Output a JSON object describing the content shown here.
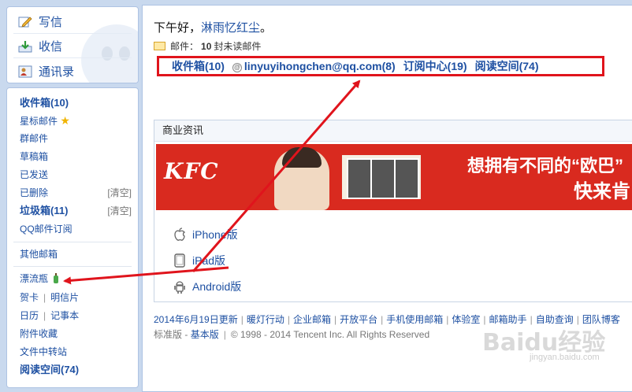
{
  "quick_actions": [
    {
      "label": "写信",
      "icon": "pencil-icon"
    },
    {
      "label": "收信",
      "icon": "inbox-download-icon"
    },
    {
      "label": "通讯录",
      "icon": "contacts-icon"
    }
  ],
  "nav": {
    "inbox": "收件箱(10)",
    "starred": "星标邮件",
    "group": "群邮件",
    "drafts": "草稿箱",
    "sent": "已发送",
    "deleted": "已删除",
    "deleted_clear": "[清空]",
    "spam": "垃圾箱(11)",
    "spam_clear": "[清空]",
    "subscription": "QQ邮件订阅",
    "other": "其他邮箱",
    "bottle": "漂流瓶",
    "card": "贺卡",
    "postcard": "明信片",
    "calendar": "日历",
    "notes": "记事本",
    "attachments": "附件收藏",
    "transfer": "文件中转站",
    "reading": "阅读空间(74)"
  },
  "greeting": {
    "prefix": "下午好，",
    "nickname": "淋雨忆红尘",
    "suffix": "。"
  },
  "mail_status": {
    "label": "邮件：",
    "count": "10",
    "suffix": "封未读邮件"
  },
  "folders": {
    "inbox": "收件箱(10)",
    "account": "linyuyihongchen@qq.com(8)",
    "subscription": "订阅中心(19)",
    "reading": "阅读空间(74)"
  },
  "business": {
    "title": "商业资讯",
    "banner": {
      "brand": "KFC",
      "line1": "想拥有不同的“欧巴”",
      "line2": "快来肯"
    },
    "downloads": [
      {
        "label": "iPhone版",
        "icon": "apple-icon"
      },
      {
        "label": "iPad版",
        "icon": "tablet-icon"
      },
      {
        "label": "Android版",
        "icon": "android-icon"
      }
    ]
  },
  "footer": {
    "links": [
      "2014年6月19日更新",
      "暖灯行动",
      "企业邮箱",
      "开放平台",
      "手机使用邮箱",
      "体验室",
      "邮箱助手",
      "自助查询",
      "团队博客"
    ],
    "version_standard": "标准版",
    "version_basic": "基本版",
    "copyright": "© 1998 - 2014 Tencent Inc. All Rights Reserved"
  },
  "watermark": {
    "text": "Baidu经验",
    "sub": "jingyan.baidu.com"
  },
  "colors": {
    "annotation_red": "#e0141c",
    "link_blue": "#1e50a2",
    "banner_red": "#d92a1f"
  }
}
